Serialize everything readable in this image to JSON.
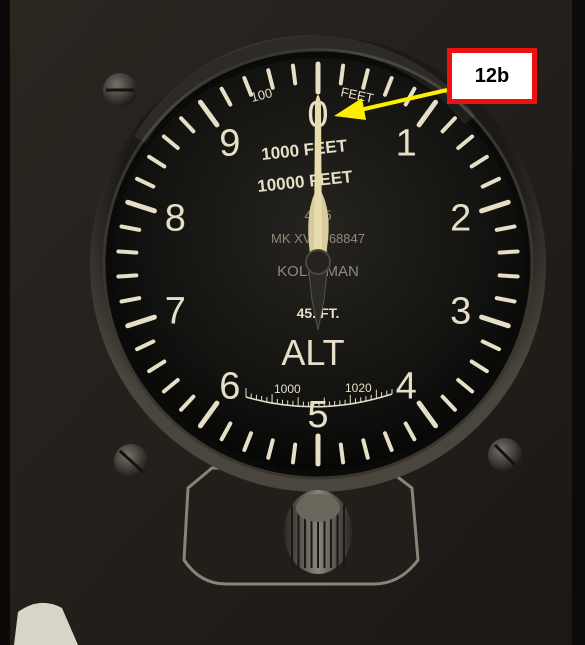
{
  "dial": {
    "numerals": [
      "0",
      "1",
      "2",
      "3",
      "4",
      "5",
      "6",
      "7",
      "8",
      "9"
    ],
    "top_feet_label": "FEET",
    "top_100_label": "100",
    "feet_1000_label": "1000 FEET",
    "feet_10000_label": "10000 FEET",
    "part_number": "4 35",
    "model_line": "MK XV  N-68847",
    "maker": "KOLLSMAN",
    "range_text": "45. FT.",
    "alt_label": "ALT",
    "baro_left": "1000",
    "baro_right": "1020"
  },
  "callout": {
    "label": "12b"
  },
  "colors": {
    "callout_border": "#ee1111",
    "arrow": "#ffee00",
    "dial_face": "#121210",
    "markings": "#e6dfc6",
    "needle": "#e8dcae"
  }
}
